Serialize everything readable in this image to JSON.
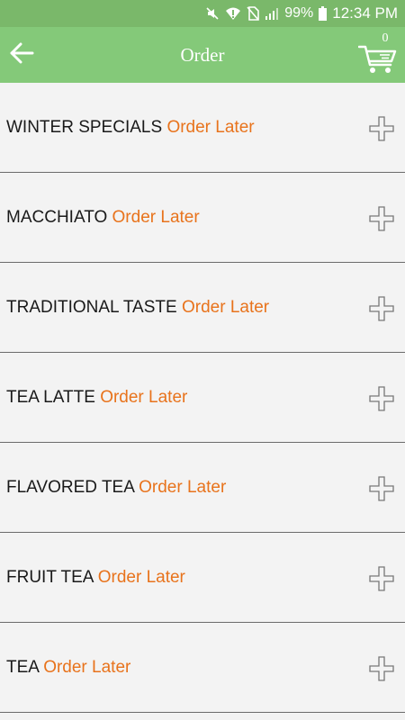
{
  "status_bar": {
    "battery": "99%",
    "time": "12:34 PM",
    "icons": [
      "mute-icon",
      "wifi-icon",
      "no-sim-icon",
      "signal-icon",
      "battery-icon"
    ]
  },
  "header": {
    "title": "Order",
    "back_icon": "arrow-left-icon",
    "cart_icon": "shopping-cart-icon",
    "cart_count": "0"
  },
  "categories": [
    {
      "name": "WINTER SPECIALS",
      "note": "Order Later"
    },
    {
      "name": "MACCHIATO",
      "note": "Order Later"
    },
    {
      "name": "TRADITIONAL TASTE",
      "note": "Order Later"
    },
    {
      "name": "TEA LATTE",
      "note": "Order Later"
    },
    {
      "name": "FLAVORED TEA",
      "note": "Order Later"
    },
    {
      "name": "FRUIT TEA",
      "note": "Order Later"
    },
    {
      "name": "TEA",
      "note": "Order Later"
    }
  ],
  "colors": {
    "status_bar": "#7ab86a",
    "app_bar": "#84c979",
    "accent": "#e8731c",
    "background": "#f3f3f3"
  }
}
